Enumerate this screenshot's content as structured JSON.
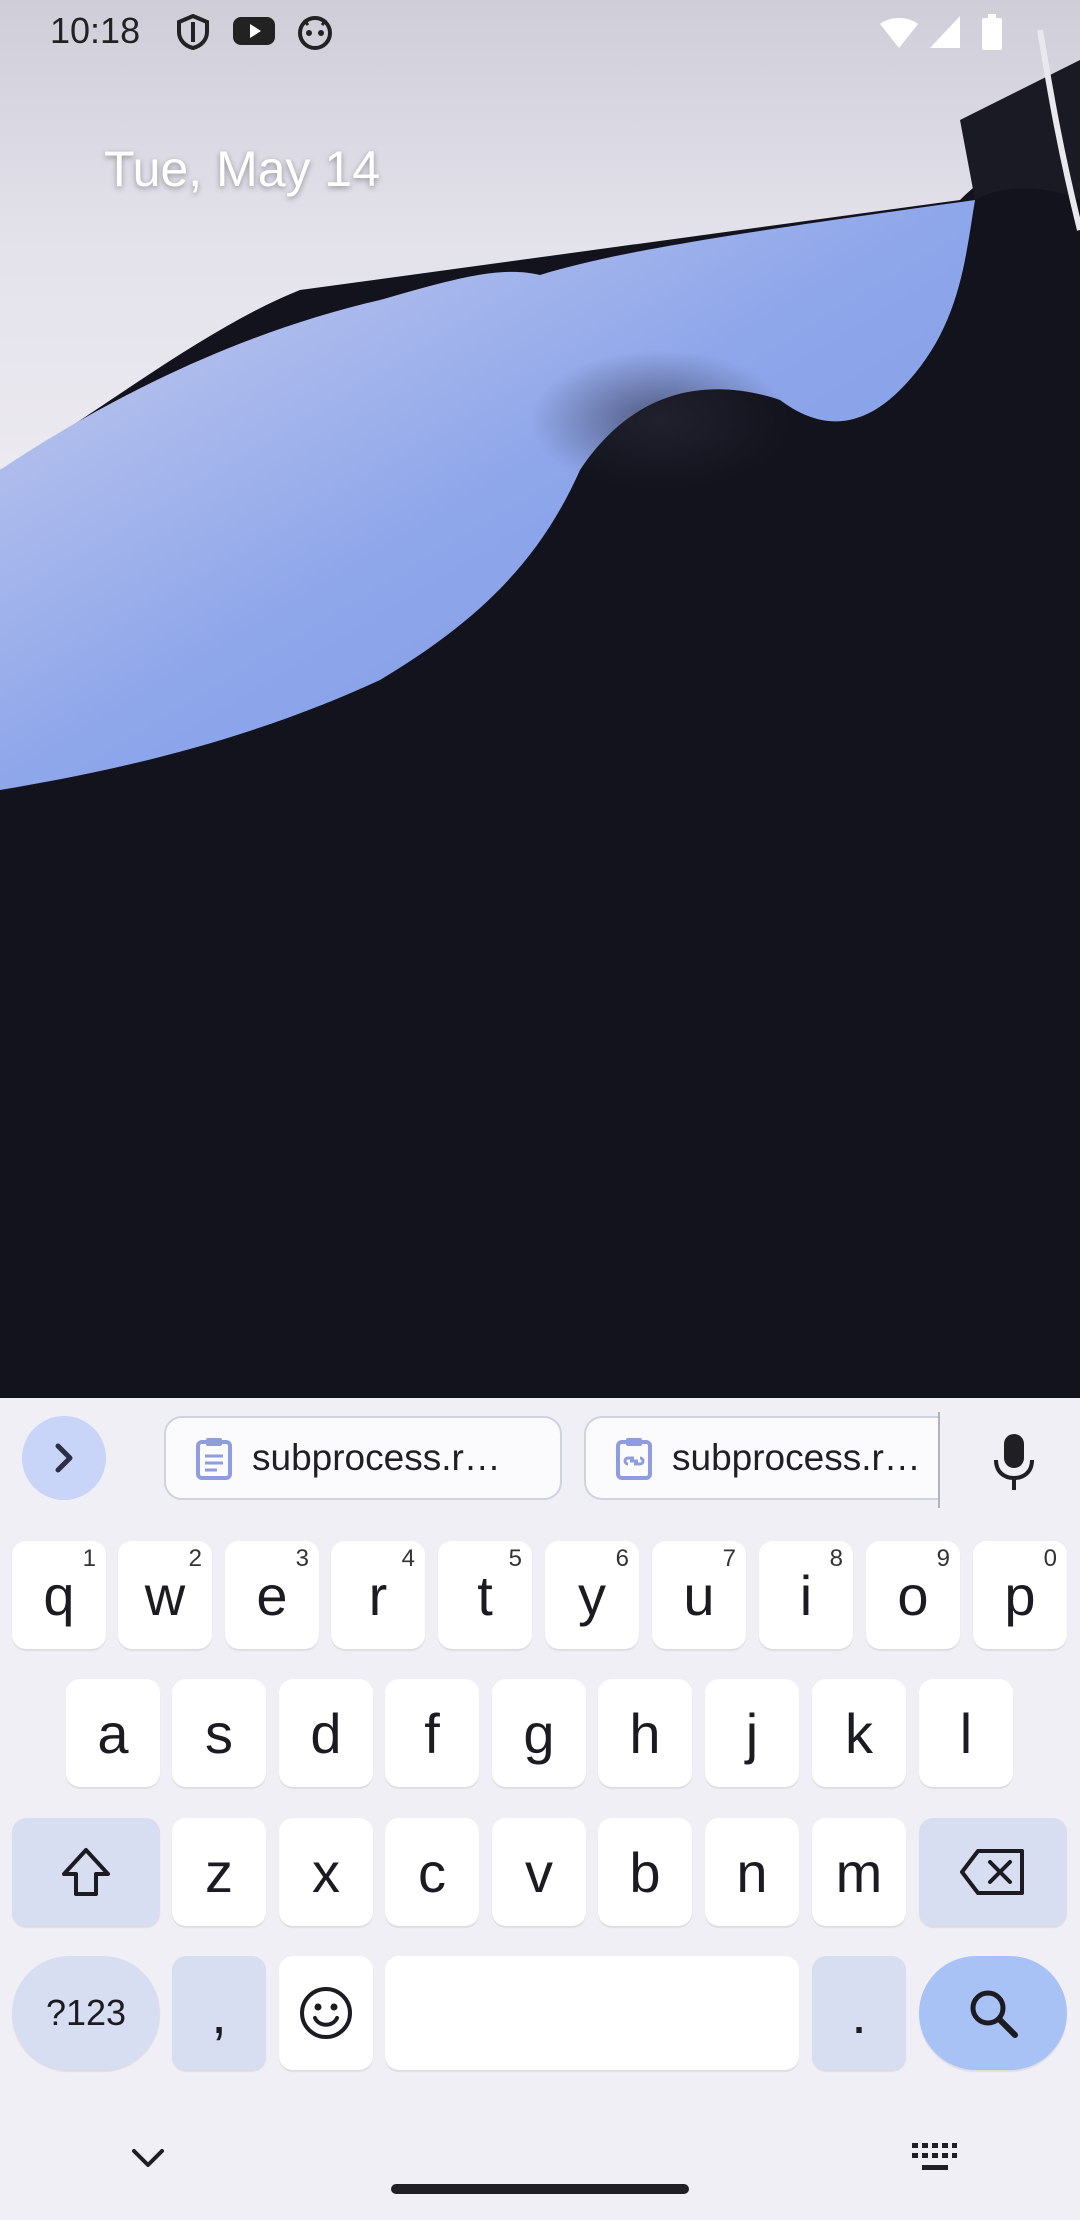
{
  "status_bar": {
    "time": "10:18",
    "left_icons": [
      "shield-icon",
      "youtube-icon",
      "android-icon"
    ],
    "right_icons": [
      "wifi-icon",
      "signal-icon",
      "battery-icon"
    ]
  },
  "lock_screen": {
    "date": "Tue, May 14"
  },
  "keyboard": {
    "suggestions": [
      {
        "icon": "clipboard-icon",
        "text": "subprocess.r…"
      },
      {
        "icon": "clipboard-link-icon",
        "text": "subprocess.r…"
      }
    ],
    "row1": [
      {
        "key": "q",
        "hint": "1"
      },
      {
        "key": "w",
        "hint": "2"
      },
      {
        "key": "e",
        "hint": "3"
      },
      {
        "key": "r",
        "hint": "4"
      },
      {
        "key": "t",
        "hint": "5"
      },
      {
        "key": "y",
        "hint": "6"
      },
      {
        "key": "u",
        "hint": "7"
      },
      {
        "key": "i",
        "hint": "8"
      },
      {
        "key": "o",
        "hint": "9"
      },
      {
        "key": "p",
        "hint": "0"
      }
    ],
    "row2": [
      "a",
      "s",
      "d",
      "f",
      "g",
      "h",
      "j",
      "k",
      "l"
    ],
    "row3": [
      "z",
      "x",
      "c",
      "v",
      "b",
      "n",
      "m"
    ],
    "symbols_label": "?123",
    "comma_label": ",",
    "period_label": ".",
    "colors": {
      "background": "#f0eff6",
      "modifier_key": "#d8def2",
      "action_key": "#a9c2f6",
      "expand_button": "#c8d4f8"
    }
  }
}
